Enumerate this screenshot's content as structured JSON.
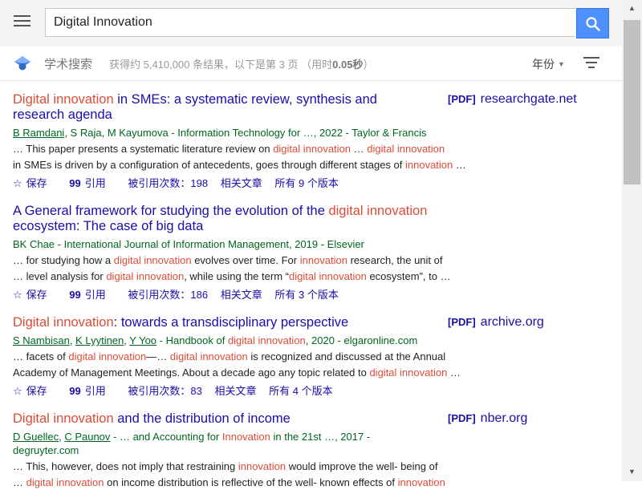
{
  "search": {
    "query": "Digital Innovation"
  },
  "header": {
    "title": "学术搜索",
    "stats_prefix": "获得约 5,410,000 条结果，以下是第 3 页 （用时",
    "stats_time": "0.05秒",
    "stats_suffix": "）",
    "year_label": "年份"
  },
  "results": [
    {
      "title_hl": "Digital innovation",
      "title_rest": " in SMEs: a systematic review, synthesis and research agenda",
      "pdf_tag": "[PDF]",
      "pdf_domain": "researchgate.net",
      "authors": [
        "B Ramdani",
        "S Raja",
        "M Kayumova"
      ],
      "source": " - Information Technology for …, 2022 - Taylor & Francis",
      "snippet1_a": "… This paper presents a systematic literature review on ",
      "snippet1_hl1": "digital innovation",
      "snippet1_b": " … ",
      "snippet1_hl2": "digital innovation",
      "snippet2_a": "in SMEs is driven by a configuration of antecedents, goes through different stages of ",
      "snippet2_hl1": "innovation",
      "snippet2_b": " …",
      "save": "保存",
      "cite": "引用",
      "cited_by": "被引用次数：198",
      "related": "相关文章",
      "versions": "所有 9 个版本"
    },
    {
      "title_a": "A General framework for studying the evolution of the ",
      "title_hl": "digital innovation",
      "title_b": " ecosystem: The case of big data",
      "source": "BK Chae - International Journal of Information Management, 2019 - Elsevier",
      "snippet1_a": "… for studying how a ",
      "snippet1_hl1": "digital innovation",
      "snippet1_b": " evolves over time. For ",
      "snippet1_hl2": "innovation",
      "snippet1_c": " research, the unit of",
      "snippet2_a": "… level analysis for ",
      "snippet2_hl1": "digital innovation",
      "snippet2_b": ", while using the term “",
      "snippet2_hl2": "digital innovation",
      "snippet2_c": " ecosystem”, to …",
      "save": "保存",
      "cite": "引用",
      "cited_by": "被引用次数：186",
      "related": "相关文章",
      "versions": "所有 3 个版本"
    },
    {
      "title_hl": "Digital innovation",
      "title_rest": ": towards a transdisciplinary perspective",
      "pdf_tag": "[PDF]",
      "pdf_domain": "archive.org",
      "authors": [
        "S Nambisan",
        "K Lyytinen",
        "Y Yoo"
      ],
      "source_a": " - Handbook of ",
      "source_hl": "digital innovation",
      "source_b": ", 2020 - elgaronline.com",
      "snippet1_a": "… facets of ",
      "snippet1_hl1": "digital innovation",
      "snippet1_b": "—… ",
      "snippet1_hl2": "digital innovation",
      "snippet1_c": " is recognized and discussed at the Annual",
      "snippet2_a": "Academy of Management Meetings. About a decade ago any topic related to ",
      "snippet2_hl1": "digital innovation",
      "snippet2_b": " …",
      "save": "保存",
      "cite": "引用",
      "cited_by": "被引用次数：83",
      "related": "相关文章",
      "versions": "所有 4 个版本"
    },
    {
      "title_hl": "Digital innovation",
      "title_rest": " and the distribution of income",
      "pdf_tag": "[PDF]",
      "pdf_domain": "nber.org",
      "authors": [
        "D Guellec",
        "C Paunov"
      ],
      "source_a": " - … and Accounting for ",
      "source_hl": "Innovation",
      "source_b": " in the 21st …, 2017 -",
      "source_line2": "degruyter.com",
      "snippet1_a": "… This, however, does not imply that restraining ",
      "snippet1_hl1": "innovation",
      "snippet1_b": " would improve the well- being of",
      "snippet2_hl1": "digital innovation",
      "snippet2_b": " on income distribution is reflective of the well- known effects of ",
      "snippet2_hl2": "innovation"
    }
  ],
  "colors": {
    "link": "#1a0dab",
    "highlight": "#dd4b39",
    "authors": "#006621",
    "search_button": "#4d90fe"
  },
  "icons": [
    "menu-icon",
    "search-icon",
    "scholar-logo-icon",
    "filter-icon",
    "star-icon",
    "quote-icon",
    "scroll-up-arrow",
    "scroll-down-arrow"
  ]
}
